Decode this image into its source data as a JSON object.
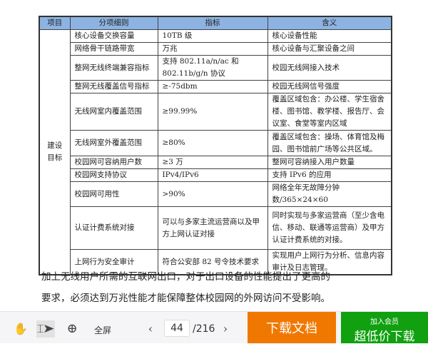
{
  "table": {
    "headers": [
      "项目",
      "分项细则",
      "指标",
      "含义"
    ],
    "category": "建设目标",
    "rows": [
      [
        "核心设备交换容量",
        "10TB 级",
        "核心设备性能"
      ],
      [
        "网络骨干链路带宽",
        "万兆",
        "核心设备与汇聚设备之间"
      ],
      [
        "整网无线终端兼容指标",
        "支持 802.11a/n/ac 和 802.11b/g/n 协议",
        "校园无线网接入技术"
      ],
      [
        "整网无线覆盖信号指标",
        "≥-75dbm",
        "校园无线网信号强度"
      ],
      [
        "无线网室内覆盖范围",
        "≥99.99%",
        "覆盖区域包含：办公楼、学生宿舍楼、图书馆、教学楼、报告厅、会议室、食堂等室内区域"
      ],
      [
        "无线网室外覆盖范围",
        "≥80%",
        "覆盖区域包含：操场、体育馆及梅园、图书馆前广场等公共区域。"
      ],
      [
        "校园网可容纳用户数",
        "≥3 万",
        "整网可容纳接入用户数量"
      ],
      [
        "校园网支持协议",
        "IPv4/IPv6",
        "支持 IPv6 的应用"
      ],
      [
        "校园网可用性",
        ">90%",
        "网络全年无故障分钟数/365×24×60"
      ],
      [
        "认证计费系统对接",
        "可以与多家主流运营商以及甲方上网认证对接",
        "同时实现与多家运营商（至少含电信、移动、联通等运营商）及甲方认证计费系统的对接。"
      ],
      [
        "上网行为安全审计",
        "符合公安部 82 号令技术要求",
        "实现用户上网行为分析、信息内容审计及日志管理。"
      ]
    ]
  },
  "paragraph": [
    "加上无线用户所需的互联网出口，对于出口设备的性能提出了更高的",
    "要求，必须达到万兆性能才能保障整体校园网的外网访问不受影响。"
  ],
  "toolbar": {
    "fullscreen": "全屏",
    "page": "44",
    "total": "/216",
    "download": "下载文档",
    "vip_top": "加入会员",
    "vip_bottom": "超低价下载"
  },
  "colors": {
    "header": "#8db3e2",
    "download": "#f07800",
    "vip": "#10a010"
  }
}
